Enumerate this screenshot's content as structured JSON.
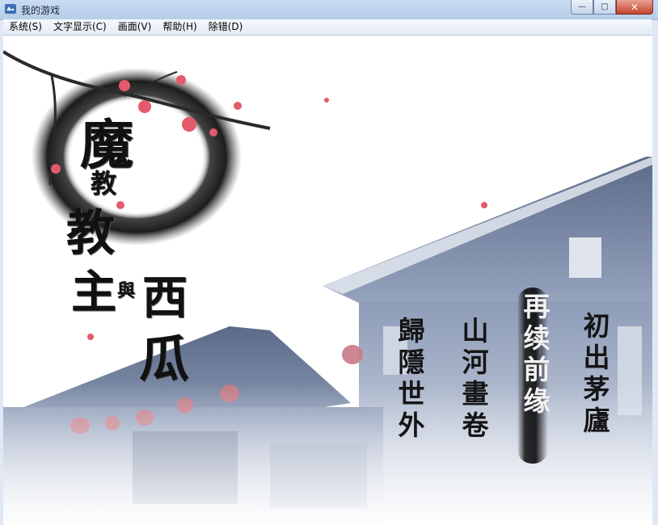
{
  "window": {
    "title": "我的游戏",
    "icon": "game-app-icon",
    "controls": {
      "minimize": "—",
      "maximize": "□",
      "close": "✕"
    }
  },
  "menubar": {
    "items": [
      {
        "label": "系统(S)"
      },
      {
        "label": "文字显示(C)"
      },
      {
        "label": "画面(V)"
      },
      {
        "label": "帮助(H)"
      },
      {
        "label": "除错(D)"
      }
    ]
  },
  "game": {
    "logo": {
      "line1": "魔",
      "line2": "教",
      "line3": "教",
      "line4": "主",
      "conjunction": "與",
      "line5": "西",
      "line6": "瓜"
    },
    "title_menu": [
      {
        "label": "初出茅廬",
        "selected": false
      },
      {
        "label": "再续前缘",
        "selected": true
      },
      {
        "label": "山河畫卷",
        "selected": false
      },
      {
        "label": "歸隱世外",
        "selected": false
      }
    ]
  }
}
